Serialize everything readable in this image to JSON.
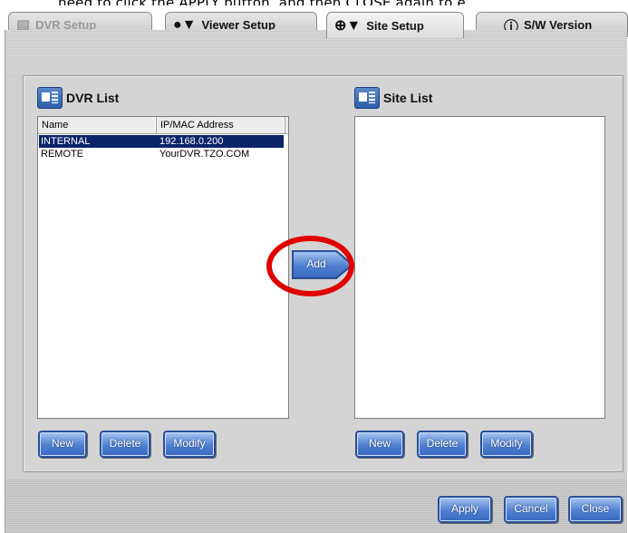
{
  "caption": "need to click the APPLY button, and then CLOSE again to e",
  "tabs": [
    {
      "label": "DVR Setup",
      "icon": "dvr-icon",
      "state": "disabled"
    },
    {
      "label": "Viewer Setup",
      "icon": "viewer-icon",
      "state": "normal"
    },
    {
      "label": "Site Setup",
      "icon": "site-icon",
      "state": "active"
    },
    {
      "label": "S/W Version",
      "icon": "info-icon",
      "state": "normal"
    }
  ],
  "dvr_list": {
    "title": "DVR List",
    "columns": [
      "Name",
      "IP/MAC Address"
    ],
    "rows": [
      {
        "name": "INTERNAL",
        "address": "192.168.0.200",
        "selected": true
      },
      {
        "name": "REMOTE",
        "address": "YourDVR.TZO.COM",
        "selected": false
      }
    ],
    "buttons": {
      "new": "New",
      "delete": "Delete",
      "modify": "Modify"
    }
  },
  "site_list": {
    "title": "Site List",
    "buttons": {
      "new": "New",
      "delete": "Delete",
      "modify": "Modify"
    }
  },
  "add_label": "Add",
  "footer": {
    "apply": "Apply",
    "cancel": "Cancel",
    "close": "Close"
  },
  "colors": {
    "button_blue": "#4e7fd0",
    "selection": "#0a246a",
    "highlight_circle": "#e00000"
  }
}
